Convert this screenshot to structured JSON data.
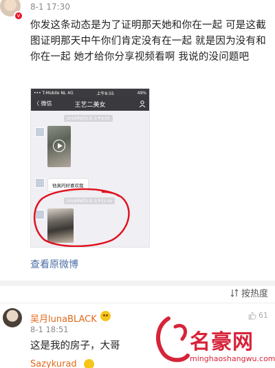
{
  "post": {
    "time": "8-1 17:30",
    "text": "你发这条动态是为了证明那天她和你在一起 可是这截图证明那天中午你们肯定没有在一起 就是因为没有和你在一起 她才给你分享视频看啊  我说的没问题吧",
    "view_original": "查看原微博"
  },
  "screenshot": {
    "carrier": "••• T-Mobile NL  4G",
    "clock": "上午8:55",
    "battery": "49%",
    "back_label": "〈 微信",
    "chat_title": "王艺二美女",
    "timestamp_1": "2018年8月1日 上午8:55",
    "timestamp_2": "2018年8月1日 上午11:00",
    "bubble_text": "他真的好喜欢我"
  },
  "sort": {
    "label": "按热度"
  },
  "comment": {
    "author": "吴月lunaBLACK",
    "time": "8-1 18:51",
    "text": "这是我的房子，大哥",
    "likes": "61"
  },
  "next_comment": {
    "author": "Sazykurad"
  },
  "watermark": {
    "brand": "名豪网",
    "url": "minghaoshangwu.com"
  },
  "colors": {
    "link": "#4e6fa6",
    "username": "#e06a1c",
    "watermark": "#d6243a",
    "annotation": "#e0121f"
  }
}
